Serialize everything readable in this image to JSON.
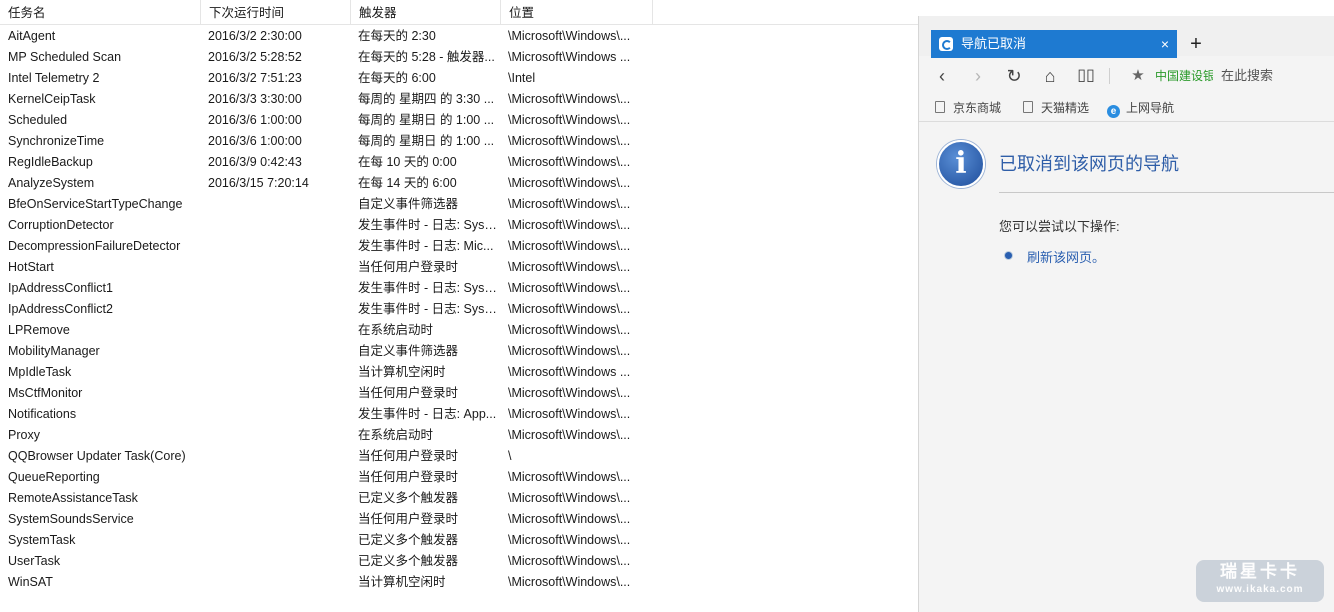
{
  "columns": {
    "name": "任务名",
    "next_run": "下次运行时间",
    "trigger": "触发器",
    "location": "位置"
  },
  "tasks": [
    {
      "name": "AitAgent",
      "next_run": "2016/3/2 2:30:00",
      "trigger": "在每天的 2:30",
      "location": "\\Microsoft\\Windows\\..."
    },
    {
      "name": "MP Scheduled Scan",
      "next_run": "2016/3/2 5:28:52",
      "trigger": "在每天的 5:28 - 触发器...",
      "location": "\\Microsoft\\Windows ..."
    },
    {
      "name": "Intel Telemetry 2",
      "next_run": "2016/3/2 7:51:23",
      "trigger": "在每天的 6:00",
      "location": "\\Intel"
    },
    {
      "name": "KernelCeipTask",
      "next_run": "2016/3/3 3:30:00",
      "trigger": "每周的 星期四 的 3:30 ...",
      "location": "\\Microsoft\\Windows\\..."
    },
    {
      "name": "Scheduled",
      "next_run": "2016/3/6 1:00:00",
      "trigger": "每周的 星期日 的 1:00 ...",
      "location": "\\Microsoft\\Windows\\..."
    },
    {
      "name": "SynchronizeTime",
      "next_run": "2016/3/6 1:00:00",
      "trigger": "每周的 星期日 的 1:00 ...",
      "location": "\\Microsoft\\Windows\\..."
    },
    {
      "name": "RegIdleBackup",
      "next_run": "2016/3/9 0:42:43",
      "trigger": "在每 10 天的 0:00",
      "location": "\\Microsoft\\Windows\\..."
    },
    {
      "name": "AnalyzeSystem",
      "next_run": "2016/3/15 7:20:14",
      "trigger": "在每 14 天的 6:00",
      "location": "\\Microsoft\\Windows\\..."
    },
    {
      "name": "BfeOnServiceStartTypeChange",
      "next_run": "",
      "trigger": "自定义事件筛选器",
      "location": "\\Microsoft\\Windows\\..."
    },
    {
      "name": "CorruptionDetector",
      "next_run": "",
      "trigger": "发生事件时 - 日志: Syst...",
      "location": "\\Microsoft\\Windows\\..."
    },
    {
      "name": "DecompressionFailureDetector",
      "next_run": "",
      "trigger": "发生事件时 - 日志: Mic...",
      "location": "\\Microsoft\\Windows\\..."
    },
    {
      "name": "HotStart",
      "next_run": "",
      "trigger": "当任何用户登录时",
      "location": "\\Microsoft\\Windows\\..."
    },
    {
      "name": "IpAddressConflict1",
      "next_run": "",
      "trigger": "发生事件时 - 日志: Syst...",
      "location": "\\Microsoft\\Windows\\..."
    },
    {
      "name": "IpAddressConflict2",
      "next_run": "",
      "trigger": "发生事件时 - 日志: Syst...",
      "location": "\\Microsoft\\Windows\\..."
    },
    {
      "name": "LPRemove",
      "next_run": "",
      "trigger": "在系统启动时",
      "location": "\\Microsoft\\Windows\\..."
    },
    {
      "name": "MobilityManager",
      "next_run": "",
      "trigger": "自定义事件筛选器",
      "location": "\\Microsoft\\Windows\\..."
    },
    {
      "name": "MpIdleTask",
      "next_run": "",
      "trigger": "当计算机空闲时",
      "location": "\\Microsoft\\Windows ..."
    },
    {
      "name": "MsCtfMonitor",
      "next_run": "",
      "trigger": "当任何用户登录时",
      "location": "\\Microsoft\\Windows\\..."
    },
    {
      "name": "Notifications",
      "next_run": "",
      "trigger": "发生事件时 - 日志: App...",
      "location": "\\Microsoft\\Windows\\..."
    },
    {
      "name": "Proxy",
      "next_run": "",
      "trigger": "在系统启动时",
      "location": "\\Microsoft\\Windows\\..."
    },
    {
      "name": "QQBrowser Updater Task(Core)",
      "next_run": "",
      "trigger": "当任何用户登录时",
      "location": "\\"
    },
    {
      "name": "QueueReporting",
      "next_run": "",
      "trigger": "当任何用户登录时",
      "location": "\\Microsoft\\Windows\\..."
    },
    {
      "name": "RemoteAssistanceTask",
      "next_run": "",
      "trigger": "已定义多个触发器",
      "location": "\\Microsoft\\Windows\\..."
    },
    {
      "name": "SystemSoundsService",
      "next_run": "",
      "trigger": "当任何用户登录时",
      "location": "\\Microsoft\\Windows\\..."
    },
    {
      "name": "SystemTask",
      "next_run": "",
      "trigger": "已定义多个触发器",
      "location": "\\Microsoft\\Windows\\..."
    },
    {
      "name": "UserTask",
      "next_run": "",
      "trigger": "已定义多个触发器",
      "location": "\\Microsoft\\Windows\\..."
    },
    {
      "name": "WinSAT",
      "next_run": "",
      "trigger": "当计算机空闲时",
      "location": "\\Microsoft\\Windows\\..."
    }
  ],
  "browser": {
    "tab_title": "导航已取消",
    "tab_close": "×",
    "new_tab": "+",
    "icons": {
      "back": "‹",
      "forward": "›",
      "refresh": "↻",
      "home": "⌂",
      "reading": "▯▯",
      "favorite": "★",
      "info": "i"
    },
    "bank_link": "中国建设银",
    "search_placeholder": "在此搜索",
    "favorites": [
      {
        "label": "京东商城",
        "icon": "page-icon"
      },
      {
        "label": "天猫精选",
        "icon": "page-icon"
      },
      {
        "label": "上网导航",
        "icon": "ie-icon"
      }
    ],
    "page": {
      "heading": "已取消到该网页的导航",
      "suggestion": "您可以尝试以下操作:",
      "refresh_link": "刷新该网页。"
    },
    "accent_color": "#1e7ad1"
  },
  "watermark": {
    "main": "瑞星卡卡",
    "sub": "www.ikaka.com"
  }
}
